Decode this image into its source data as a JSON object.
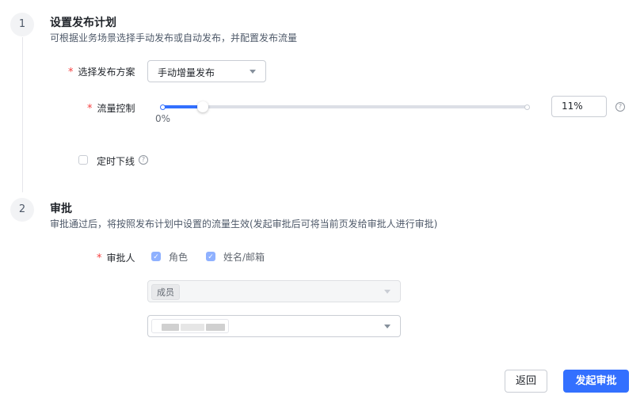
{
  "steps": [
    {
      "number": "1",
      "title": "设置发布计划",
      "description": "可根据业务场景选择手动发布或自动发布，并配置发布流量"
    },
    {
      "number": "2",
      "title": "审批",
      "description": "审批通过后，将按照发布计划中设置的流量生效(发起审批后可将当前页发给审批人进行审批)"
    }
  ],
  "release_plan": {
    "required_mark": "*",
    "plan_label": "选择发布方案",
    "plan_value": "手动增量发布",
    "traffic_label": "流量控制",
    "slider_min_label": "0%",
    "traffic_value": "11%",
    "traffic_fraction": 0.11,
    "scheduled_offline_label": "定时下线",
    "scheduled_offline_checked": false,
    "help_glyph": "?"
  },
  "approval": {
    "required_mark": "*",
    "approver_label": "审批人",
    "options": [
      {
        "label": "角色",
        "checked": true
      },
      {
        "label": "姓名/邮箱",
        "checked": true
      }
    ],
    "role_tag": "成员"
  },
  "footer": {
    "back_label": "返回",
    "submit_label": "发起审批"
  },
  "colors": {
    "primary": "#3370ff",
    "required": "#f53f3f",
    "checkbox_disabled": "#8fb1ff"
  },
  "icons": [
    "help-icon",
    "chevron-down-icon",
    "check-icon"
  ]
}
